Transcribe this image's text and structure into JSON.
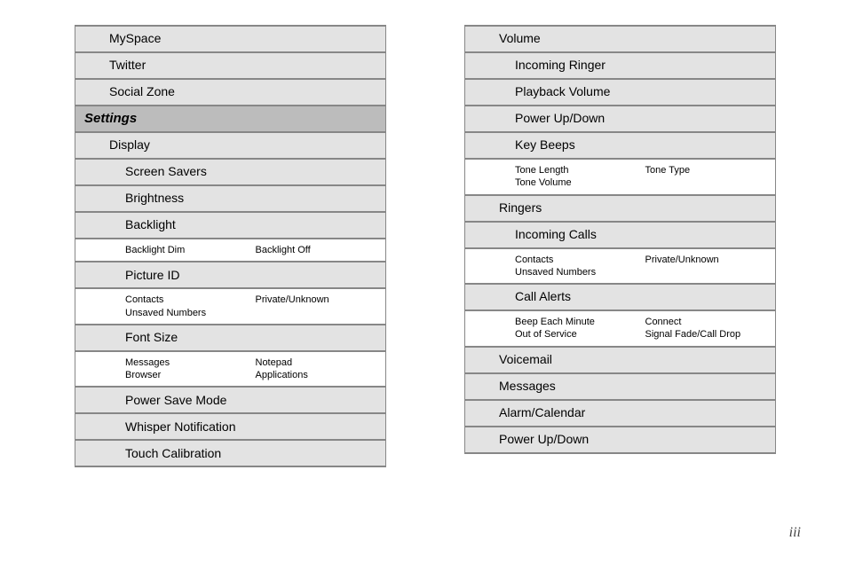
{
  "page_number": "iii",
  "left_column": [
    {
      "type": "lvl1",
      "text": "MySpace"
    },
    {
      "type": "lvl1",
      "text": "Twitter"
    },
    {
      "type": "lvl1",
      "text": "Social Zone"
    },
    {
      "type": "section",
      "text": "Settings"
    },
    {
      "type": "lvl1",
      "text": "Display"
    },
    {
      "type": "lvl2",
      "text": "Screen Savers"
    },
    {
      "type": "lvl2",
      "text": "Brightness"
    },
    {
      "type": "lvl2",
      "text": "Backlight"
    },
    {
      "type": "leaf",
      "left": [
        "Backlight Dim"
      ],
      "right": [
        "Backlight Off"
      ]
    },
    {
      "type": "lvl2",
      "text": "Picture ID"
    },
    {
      "type": "leaf",
      "left": [
        "Contacts",
        "Unsaved Numbers"
      ],
      "right": [
        "Private/Unknown"
      ]
    },
    {
      "type": "lvl2",
      "text": "Font Size"
    },
    {
      "type": "leaf",
      "left": [
        "Messages",
        "Browser"
      ],
      "right": [
        "Notepad",
        "Applications"
      ]
    },
    {
      "type": "lvl2",
      "text": "Power Save Mode"
    },
    {
      "type": "lvl2",
      "text": "Whisper Notification"
    },
    {
      "type": "lvl2",
      "text": "Touch Calibration"
    }
  ],
  "right_column": [
    {
      "type": "lvl1",
      "text": "Volume"
    },
    {
      "type": "lvl2",
      "text": "Incoming Ringer"
    },
    {
      "type": "lvl2",
      "text": "Playback Volume"
    },
    {
      "type": "lvl2",
      "text": "Power Up/Down"
    },
    {
      "type": "lvl2",
      "text": "Key Beeps"
    },
    {
      "type": "leaf",
      "left": [
        "Tone Length",
        "Tone Volume"
      ],
      "right": [
        "Tone Type"
      ]
    },
    {
      "type": "lvl1",
      "text": "Ringers"
    },
    {
      "type": "lvl2",
      "text": "Incoming Calls"
    },
    {
      "type": "leaf",
      "left": [
        "Contacts",
        "Unsaved Numbers"
      ],
      "right": [
        "Private/Unknown"
      ]
    },
    {
      "type": "lvl2",
      "text": "Call Alerts"
    },
    {
      "type": "leaf",
      "left": [
        "Beep Each Minute",
        "Out of Service"
      ],
      "right": [
        "Connect",
        "Signal Fade/Call Drop"
      ]
    },
    {
      "type": "lvl1",
      "text": "Voicemail"
    },
    {
      "type": "lvl1",
      "text": "Messages"
    },
    {
      "type": "lvl1",
      "text": "Alarm/Calendar"
    },
    {
      "type": "lvl1",
      "text": "Power Up/Down"
    }
  ]
}
